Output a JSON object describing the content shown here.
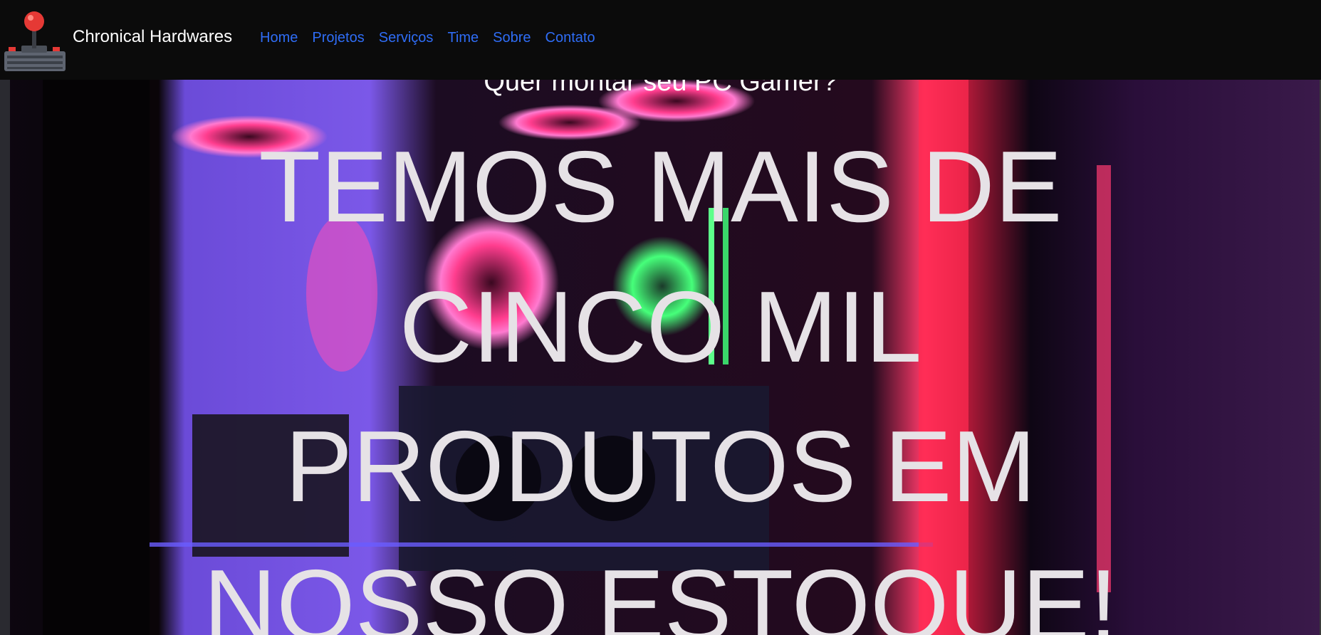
{
  "navbar": {
    "brand": "Chronical Hardwares",
    "links": [
      "Home",
      "Projetos",
      "Serviços",
      "Time",
      "Sobre",
      "Contato"
    ],
    "link_color": "#2f6df6",
    "logo_icon": "joystick-icon"
  },
  "hero": {
    "subtitle": "Quer montar seu PC Gamer?",
    "headline_lines": [
      "TEMOS MAIS DE",
      "CINCO MIL",
      "PRODUTOS EM",
      "NOSSO ESTOQUE!"
    ],
    "background": "gaming-pc-rgb-image"
  }
}
